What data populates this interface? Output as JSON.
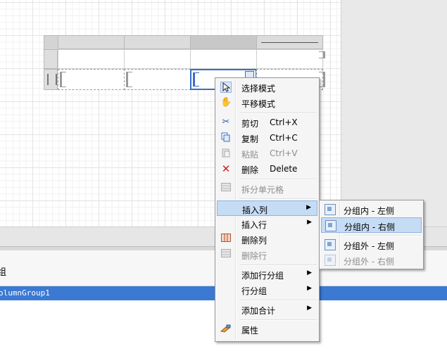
{
  "panel": {
    "group_label": "组",
    "selected_group": "olumnGroup1"
  },
  "context_menu": {
    "items": [
      {
        "label": "选择模式",
        "icon": "arrow-cursor-icon"
      },
      {
        "label": "平移模式",
        "icon": "hand-icon"
      },
      {
        "label": "剪切",
        "shortcut": "Ctrl+X",
        "icon": "scissors-icon"
      },
      {
        "label": "复制",
        "shortcut": "Ctrl+C",
        "icon": "copy-icon"
      },
      {
        "label": "粘贴",
        "shortcut": "Ctrl+V",
        "icon": "paste-icon",
        "disabled": true
      },
      {
        "label": "删除",
        "shortcut": "Delete",
        "icon": "delete-x-icon"
      },
      {
        "label": "拆分单元格",
        "icon": "split-cells-icon",
        "disabled": true
      },
      {
        "label": "插入列",
        "arrow": "▶",
        "highlighted": true
      },
      {
        "label": "插入行",
        "arrow": "▶"
      },
      {
        "label": "删除列",
        "icon": "delete-column-icon"
      },
      {
        "label": "删除行",
        "icon": "delete-row-icon",
        "disabled": true
      },
      {
        "label": "添加行分组",
        "arrow": "▶"
      },
      {
        "label": "行分组",
        "arrow": "▶"
      },
      {
        "label": "添加合计",
        "arrow": "▶"
      },
      {
        "label": "属性",
        "icon": "properties-icon"
      }
    ]
  },
  "submenu": {
    "items": [
      {
        "label": "分组内 - 左侧"
      },
      {
        "label": "分组内 - 右侧",
        "highlighted": true
      },
      {
        "label": "分组外 - 左侧"
      },
      {
        "label": "分组外 - 右侧",
        "disabled": true
      }
    ]
  },
  "colors": {
    "selection_blue": "#3b79d3",
    "menu_highlight": "#c5dcf4",
    "delete_red": "#d11f1f"
  }
}
